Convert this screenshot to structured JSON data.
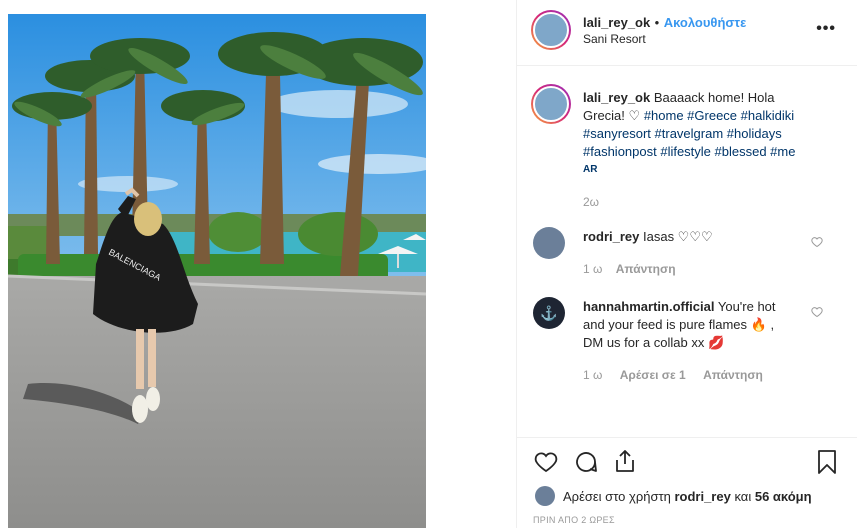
{
  "post": {
    "username": "lali_rey_ok",
    "follow_label": "Ακολουθήστε",
    "separator": "•",
    "location": "Sani Resort",
    "more_label": "•••"
  },
  "caption": {
    "username": "lali_rey_ok",
    "text_1": "Baaaack home! Hola",
    "text_2": "Grecia!",
    "tags_1": "#home #Greece #halkidiki",
    "tags_2": "#sanyresort #travelgram #holidays",
    "tags_3": "#fashionpost #lifestyle #blessed #me",
    "extra": "AR",
    "time": "2ω"
  },
  "comments": [
    {
      "username": "rodri_rey",
      "text": "Iasas ♡♡♡",
      "time": "1 ω",
      "reply": "Απάντηση"
    },
    {
      "username": "hannahmartin.official",
      "text_1": "You're hot",
      "text_2": "and your feed is pure flames 🔥 ,",
      "text_3": "DM us for a collab xx 💋",
      "time": "1 ω",
      "likes": "Αρέσει σε 1",
      "reply": "Απάντηση"
    }
  ],
  "likes": {
    "prefix": "Αρέσει στο χρήστη",
    "user": "rodri_rey",
    "middle": "και",
    "count": "56 ακόμη"
  },
  "timestamp": "ΠΡΙΝ ΑΠΟ 2 ΩΡΕΣ",
  "icons": [
    "heart-icon",
    "comment-icon",
    "share-icon",
    "bookmark-icon",
    "more-icon"
  ]
}
